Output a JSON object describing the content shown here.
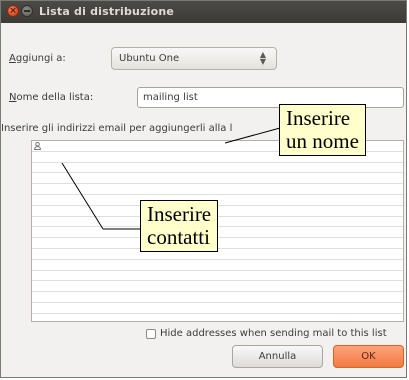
{
  "window": {
    "title": "Lista di distribuzione",
    "close_icon_glyph": "×"
  },
  "form": {
    "add_to_mnemonic": "A",
    "add_to_label_rest": "ggiungi a:",
    "add_to_value": "Ubuntu One",
    "list_name_mnemonic": "N",
    "list_name_label_rest": "ome della lista:",
    "list_name_value": "mailing list",
    "addresses_instructions": "Inserire gli indirizzi email per aggiungerli alla l",
    "hide_addresses_label": "Hide addresses when sending mail to this list",
    "hide_addresses_checked": false
  },
  "buttons": {
    "cancel_label": "Annulla",
    "ok_label": "OK"
  },
  "annotations": {
    "callout_name_line1": "Inserire",
    "callout_name_line2": "un nome",
    "callout_contacts_line1": "Inserire",
    "callout_contacts_line2": "contatti",
    "callout_background": "#ffffcc"
  },
  "colors": {
    "titlebar": "#3c3b37",
    "ok_button": "#f27a43",
    "window_background": "#f2f1f0"
  },
  "icons": {
    "window_close": "close-icon",
    "window_minimize": "minimize-icon",
    "combo_arrows": "up-down-arrows-icon",
    "address_row": "person-icon"
  }
}
